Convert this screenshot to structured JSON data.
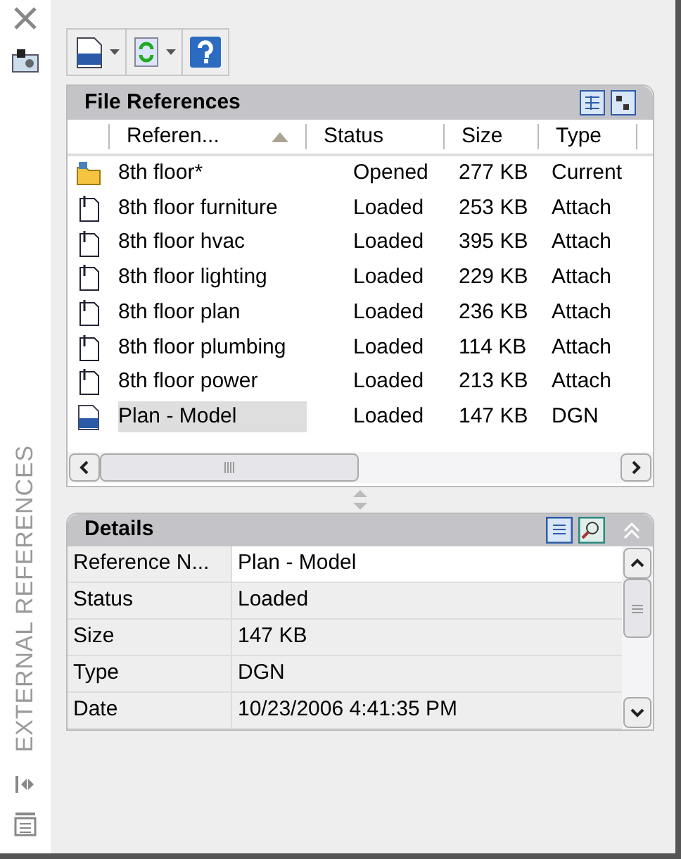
{
  "palette_title": "EXTERNAL REFERENCES",
  "file_references": {
    "title": "File References",
    "columns": [
      {
        "label": "Referen...",
        "sorted": true
      },
      {
        "label": "Status",
        "sorted": false
      },
      {
        "label": "Size",
        "sorted": false
      },
      {
        "label": "Type",
        "sorted": false
      }
    ],
    "rows": [
      {
        "kind": "current",
        "name": "8th floor*",
        "status": "Opened",
        "size": "277 KB",
        "type": "Current",
        "selected": false
      },
      {
        "kind": "attach",
        "name": "8th floor furniture",
        "status": "Loaded",
        "size": "253 KB",
        "type": "Attach",
        "selected": false
      },
      {
        "kind": "attach",
        "name": "8th floor hvac",
        "status": "Loaded",
        "size": "395 KB",
        "type": "Attach",
        "selected": false
      },
      {
        "kind": "attach",
        "name": "8th floor lighting",
        "status": "Loaded",
        "size": "229 KB",
        "type": "Attach",
        "selected": false
      },
      {
        "kind": "attach",
        "name": "8th floor plan",
        "status": "Loaded",
        "size": "236 KB",
        "type": "Attach",
        "selected": false
      },
      {
        "kind": "attach",
        "name": "8th floor plumbing",
        "status": "Loaded",
        "size": "114 KB",
        "type": "Attach",
        "selected": false
      },
      {
        "kind": "attach",
        "name": "8th floor power",
        "status": "Loaded",
        "size": "213 KB",
        "type": "Attach",
        "selected": false
      },
      {
        "kind": "dgn",
        "name": "Plan - Model",
        "status": "Loaded",
        "size": "147 KB",
        "type": "DGN",
        "selected": true
      }
    ]
  },
  "details": {
    "title": "Details",
    "rows": [
      {
        "label": "Reference N...",
        "value": "Plan - Model",
        "selected": true
      },
      {
        "label": "Status",
        "value": "Loaded",
        "selected": false
      },
      {
        "label": "Size",
        "value": "147 KB",
        "selected": false
      },
      {
        "label": "Type",
        "value": "DGN",
        "selected": false
      },
      {
        "label": "Date",
        "value": "10/23/2006 4:41:35 PM",
        "selected": false
      }
    ]
  }
}
